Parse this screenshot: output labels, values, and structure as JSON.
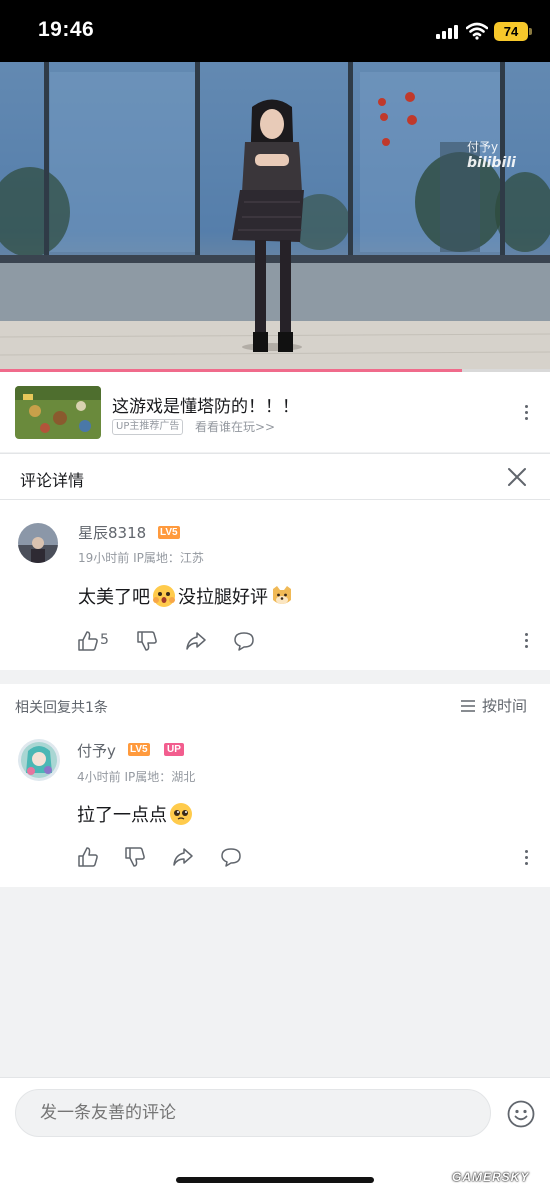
{
  "status_bar": {
    "time": "19:46",
    "battery": "74"
  },
  "video": {
    "watermark_user": "付予y",
    "watermark_brand": "bilibili",
    "progress_fraction": 0.84
  },
  "ad": {
    "title": "这游戏是懂塔防的！！！",
    "tag": "UP主推荐广告",
    "sub": "看看谁在玩>>"
  },
  "panel": {
    "title": "评论详情"
  },
  "main_comment": {
    "username": "星辰8318",
    "level": "LV5",
    "time": "19小时前",
    "ip": "IP属地：江苏",
    "text_part1": "太美了吧",
    "text_part2": "没拉腿好评",
    "like_count": "5"
  },
  "replies_header": {
    "count_text": "相关回复共1条",
    "sort_label": "按时间"
  },
  "reply": {
    "username": "付予y",
    "level": "LV5",
    "badge": "UP",
    "time": "4小时前",
    "ip": "IP属地：湖北",
    "text": "拉了一点点"
  },
  "input": {
    "placeholder": "发一条友善的评论"
  },
  "watermark": "GAMERSKY",
  "colors": {
    "accent_pink": "#f25d8e",
    "level_orange": "#ff9a3d",
    "progress": "#f06b8b"
  }
}
